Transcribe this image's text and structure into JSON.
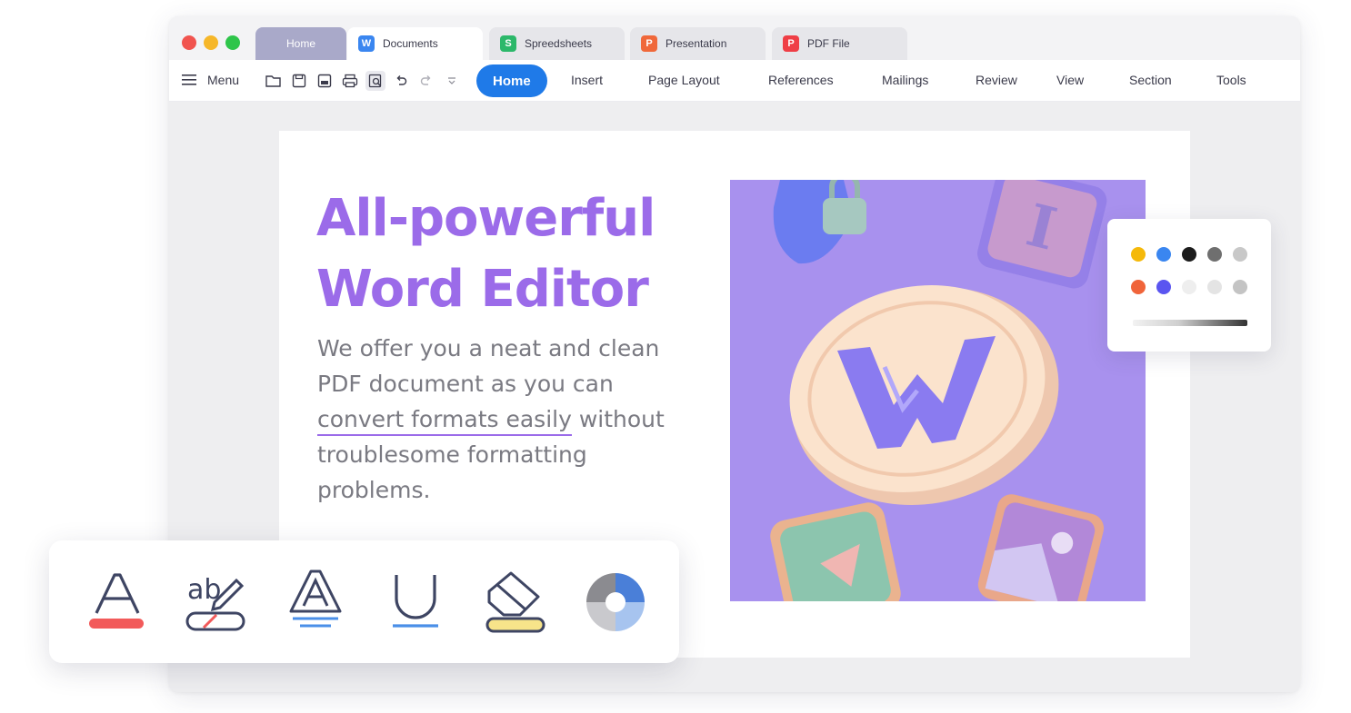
{
  "window": {
    "traffic_lights": [
      "#f1544f",
      "#f6b729",
      "#2ec54a"
    ],
    "tabs": [
      {
        "label": "Home"
      },
      {
        "label": "Documents",
        "icon": "W",
        "icon_color": "#3a86f0"
      },
      {
        "label": "Spreedsheets",
        "icon": "S",
        "icon_color": "#2cb86a"
      },
      {
        "label": "Presentation",
        "icon": "P",
        "icon_color": "#f0683a"
      },
      {
        "label": "PDF File",
        "icon": "P",
        "icon_color": "#ef3e46"
      }
    ]
  },
  "menubar": {
    "menu_label": "Menu",
    "toolbar_icons": [
      "open-folder-icon",
      "save-icon",
      "export-pdf-icon",
      "print-icon",
      "print-preview-icon",
      "undo-icon",
      "redo-icon",
      "more-icon"
    ],
    "ribbon_tabs": [
      "Home",
      "Insert",
      "Page Layout",
      "References",
      "Mailings",
      "Review",
      "View",
      "Section",
      "Tools"
    ]
  },
  "document": {
    "headline_line1": "All-powerful",
    "headline_line2": "Word Editor",
    "body_line1": "We offer you a neat and clean",
    "body_line2": "PDF document as you can",
    "body_line3_underlined": "convert formats easily",
    "body_line3_rest": " without",
    "body_line4": "troublesome formatting",
    "body_line5": "problems."
  },
  "palette": {
    "row1": [
      "#f5b90a",
      "#3a86f0",
      "#1c1c1c",
      "#6f6f6f",
      "#c8c8c8"
    ],
    "row2": [
      "#f0643a",
      "#5a55f0",
      "#eeeeee",
      "#e4e4e4",
      "#c4c4c4"
    ]
  },
  "format_tools": [
    "font-color-icon",
    "spell-check-icon",
    "text-effect-icon",
    "underline-icon",
    "highlight-icon",
    "color-wheel-icon"
  ],
  "colors": {
    "accent": "#9b6be9",
    "brand_blue": "#1f7ae8",
    "hero_bg": "#a891ee"
  }
}
